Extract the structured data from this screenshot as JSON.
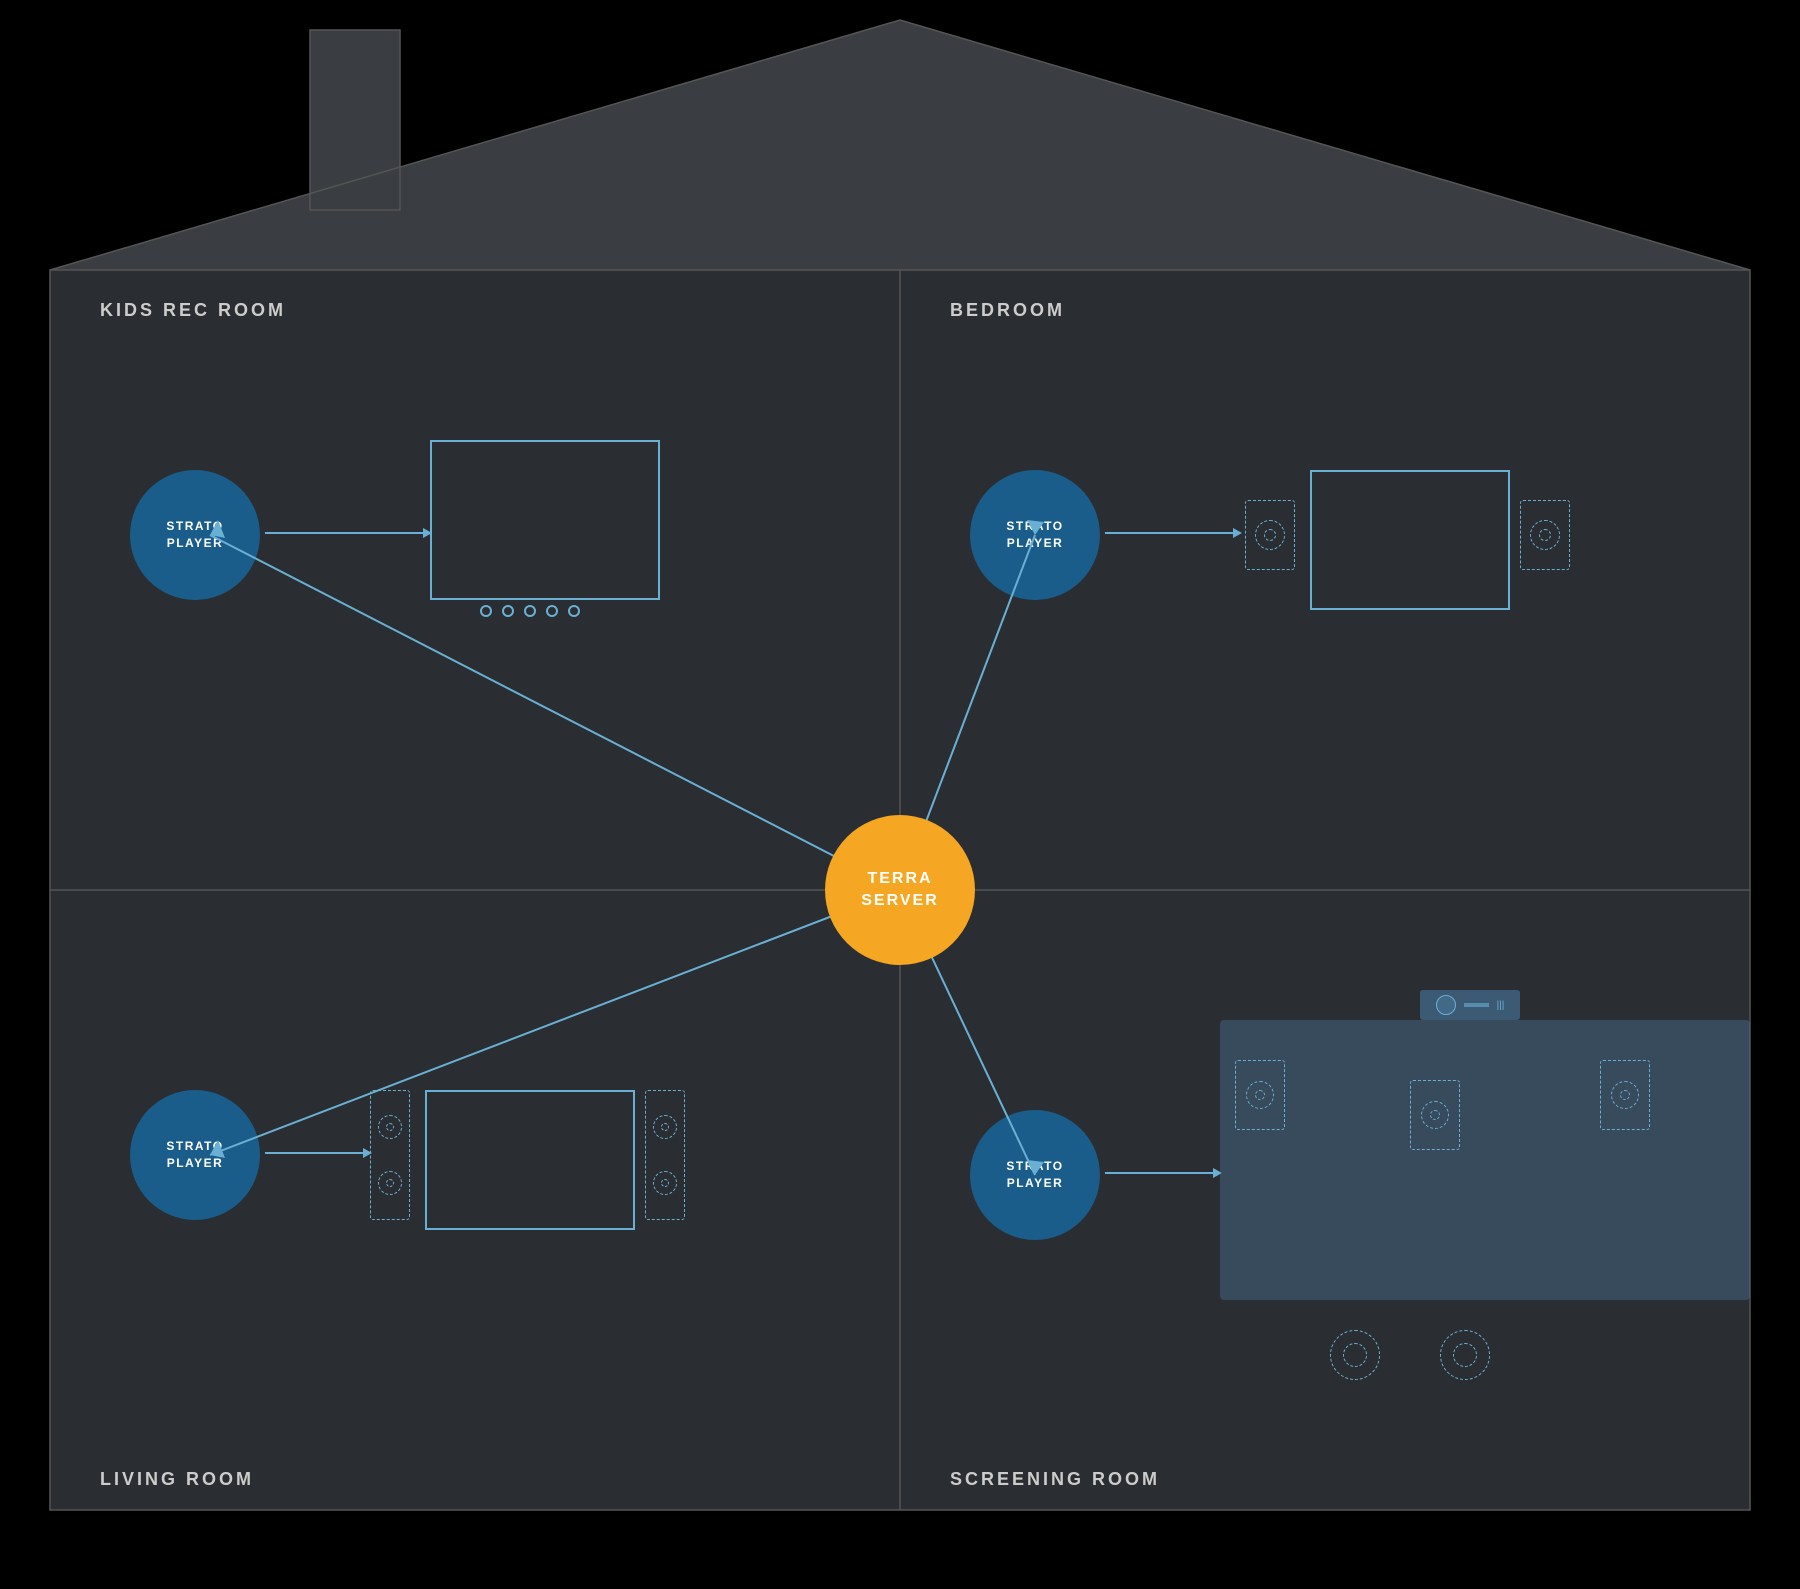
{
  "colors": {
    "background": "#111213",
    "room_bg": "#2a2d31",
    "room_border": "#555",
    "strato_player_bg": "#1a5c8a",
    "terra_server_bg": "#f5a623",
    "accent_blue": "#6ab0d4",
    "text_label": "#cccccc",
    "house_silhouette": "#3a3d42",
    "screening_room_bg": "#5b8db5"
  },
  "rooms": {
    "top_left": {
      "title": "KIDS REC ROOM",
      "player_label": "STRATO\nPLAYER"
    },
    "top_right": {
      "title": "BEDROOM",
      "player_label": "STRATO\nPLAYER"
    },
    "bottom_left": {
      "title": "LIVING ROOM",
      "player_label": "STRATO\nPLAYER"
    },
    "bottom_right": {
      "title": "SCREENING ROOM",
      "player_label": "STRATO\nPLAYER"
    }
  },
  "center": {
    "label_line1": "TERRA",
    "label_line2": "SERVER"
  }
}
